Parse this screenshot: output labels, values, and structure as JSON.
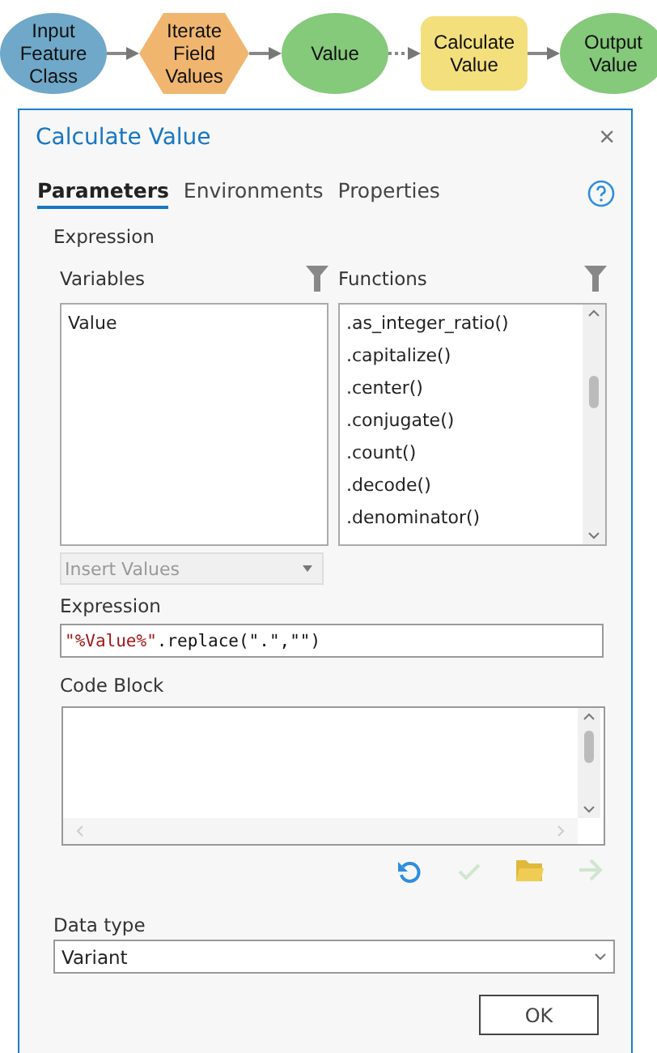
{
  "model": {
    "nodes": [
      {
        "label": "Input Feature Class",
        "kind": "ellipse",
        "color": "#6fa8c8"
      },
      {
        "label": "Iterate Field Values",
        "kind": "hexagon",
        "color": "#f0b670"
      },
      {
        "label": "Value",
        "kind": "ellipse",
        "color": "#85c97a"
      },
      {
        "label": "Calculate Value",
        "kind": "rect",
        "color": "#f3e07c"
      },
      {
        "label": "Output Value",
        "kind": "ellipse",
        "color": "#85c97a"
      }
    ],
    "connectors": [
      {
        "kind": "solid"
      },
      {
        "kind": "solid"
      },
      {
        "kind": "dotted"
      },
      {
        "kind": "solid"
      }
    ]
  },
  "dialog": {
    "title": "Calculate Value",
    "close": "×",
    "tabs": [
      {
        "label": "Parameters",
        "selected": true
      },
      {
        "label": "Environments",
        "selected": false
      },
      {
        "label": "Properties",
        "selected": false
      }
    ],
    "section": "Expression",
    "variables": {
      "label": "Variables",
      "items": [
        "Value"
      ]
    },
    "functions": {
      "label": "Functions",
      "items": [
        ".as_integer_ratio()",
        ".capitalize()",
        ".center()",
        ".conjugate()",
        ".count()",
        ".decode()",
        ".denominator()"
      ]
    },
    "insert_values": {
      "placeholder": "Insert Values",
      "disabled": true
    },
    "expression": {
      "label": "Expression",
      "string_part": "\"%Value%\"",
      "rest": ".replace(\".\",\"\")"
    },
    "code_block": {
      "label": "Code Block"
    },
    "data_type": {
      "label": "Data type",
      "value": "Variant"
    },
    "ok": "OK"
  }
}
